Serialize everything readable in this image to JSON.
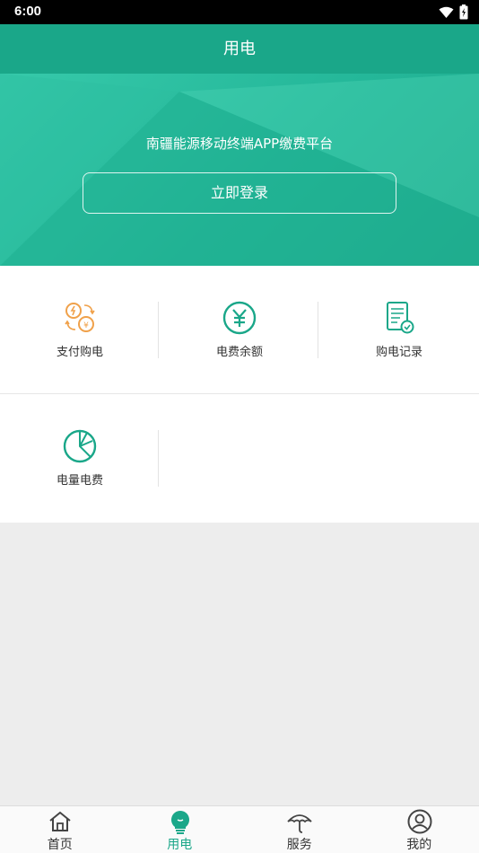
{
  "status_bar": {
    "time": "6:00"
  },
  "app_bar": {
    "title": "用电"
  },
  "banner": {
    "subtitle": "南疆能源移动终端APP缴费平台",
    "login_label": "立即登录"
  },
  "grid": {
    "items": [
      {
        "label": "支付购电",
        "icon": "exchange-icon"
      },
      {
        "label": "电费余额",
        "icon": "yen-icon"
      },
      {
        "label": "购电记录",
        "icon": "record-icon"
      },
      {
        "label": "电量电费",
        "icon": "pie-chart-icon"
      }
    ]
  },
  "tabs": [
    {
      "label": "首页",
      "icon": "home-icon",
      "active": false
    },
    {
      "label": "用电",
      "icon": "bulb-icon",
      "active": true
    },
    {
      "label": "服务",
      "icon": "umbrella-icon",
      "active": false
    },
    {
      "label": "我的",
      "icon": "user-icon",
      "active": false
    }
  ],
  "colors": {
    "primary": "#1aa789",
    "orange": "#f0a14a",
    "text": "#333333"
  }
}
